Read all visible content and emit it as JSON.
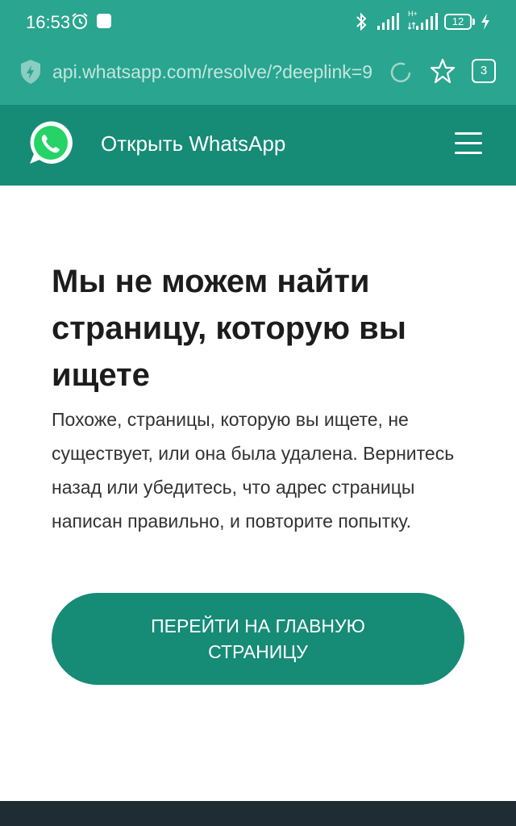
{
  "status_bar": {
    "time": "16:53",
    "network_type": "H+",
    "battery_level": "12",
    "icons": [
      "alarm-icon",
      "notification-icon",
      "bluetooth-icon",
      "signal-icon",
      "battery-icon",
      "charging-icon"
    ]
  },
  "browser": {
    "url": "api.whatsapp.com/resolve/?deeplink=9",
    "tab_count": "3",
    "icons": [
      "shield-icon",
      "reload-icon",
      "star-icon"
    ]
  },
  "header": {
    "title": "Открыть WhatsApp",
    "icons": [
      "whatsapp-logo-icon",
      "hamburger-menu-icon"
    ]
  },
  "main": {
    "headline": "Мы не можем найти страницу, которую вы ищете",
    "body": "Похоже, страницы, которую вы ищете, не существует, или она была удалена. Вернитесь назад или убедитесь, что адрес страницы написан правильно, и повторите попытку.",
    "button_label": "ПЕРЕЙТИ НА ГЛАВНУЮ СТРАНИЦУ"
  },
  "colors": {
    "status_bar": "#2aa58f",
    "header": "#168b76",
    "button": "#168b76",
    "footer": "#1f2c34",
    "headline_text": "#1c1c1c"
  }
}
